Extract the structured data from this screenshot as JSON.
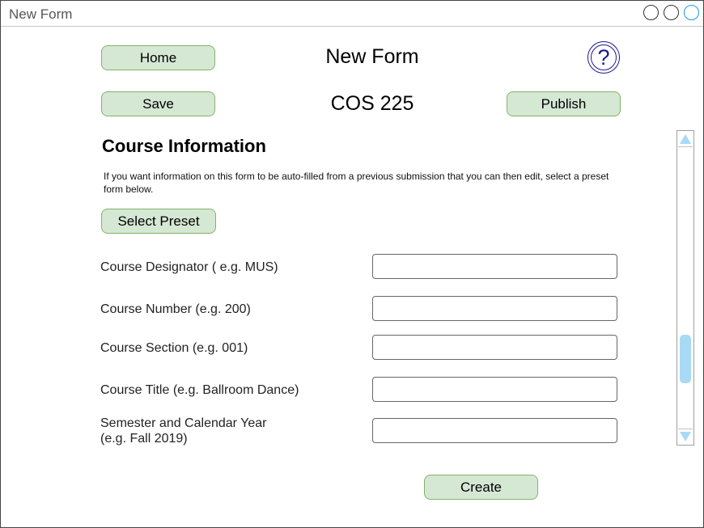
{
  "window": {
    "title": "New Form",
    "controls": [
      "circle-icon",
      "circle-icon",
      "circle-icon"
    ]
  },
  "header": {
    "home_label": "Home",
    "page_title": "New Form",
    "help_glyph": "?",
    "save_label": "Save",
    "course_title": "COS 225",
    "publish_label": "Publish"
  },
  "section": {
    "title": "Course Information",
    "description": "If you want information on this form to be auto-filled from a previous submission that you can then edit, select a preset form below.",
    "select_preset_label": "Select Preset"
  },
  "fields": [
    {
      "label": "Course Designator ( e.g. MUS)",
      "value": ""
    },
    {
      "label": "Course Number (e.g. 200)",
      "value": ""
    },
    {
      "label": "Course Section (e.g. 001)",
      "value": ""
    },
    {
      "label": "Course Title (e.g. Ballroom Dance)",
      "value": ""
    },
    {
      "label_line1": "Semester and Calendar Year",
      "label_line2": "(e.g. Fall 2019)",
      "value": ""
    }
  ],
  "create_label": "Create",
  "colors": {
    "button_fill": "#d5e8d4",
    "button_border": "#82b366",
    "help_icon": "#1a1a8c",
    "scroll_accent": "#a8daf5"
  }
}
